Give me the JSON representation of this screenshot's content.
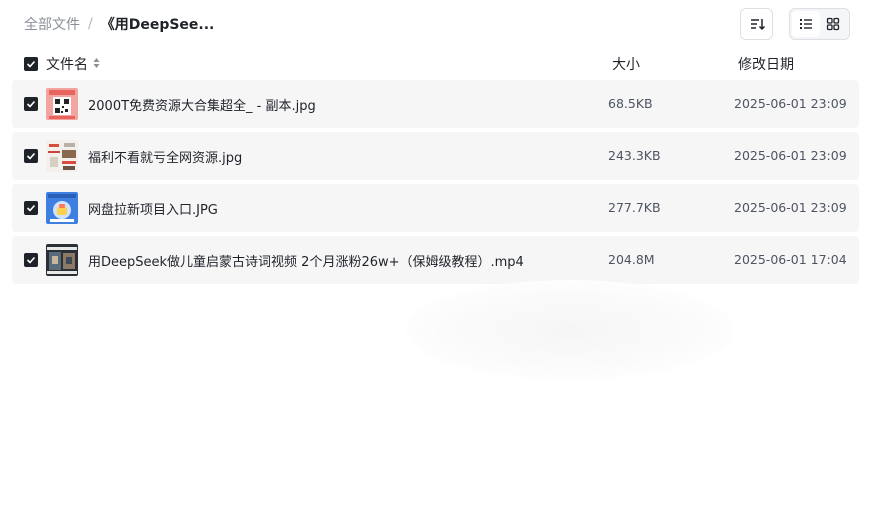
{
  "breadcrumb": {
    "root": "全部文件",
    "separator": "/",
    "current": "《用DeepSee..."
  },
  "toolbar": {
    "sort_icon": "sort-icon",
    "list_view_icon": "list-view-icon",
    "grid_view_icon": "grid-view-icon",
    "active_view": "list"
  },
  "columns": {
    "name": "文件名",
    "size": "大小",
    "modified": "修改日期"
  },
  "files": [
    {
      "name": "2000T免费资源大合集超全_ - 副本.jpg",
      "size": "68.5KB",
      "date": "2025-06-01 23:09",
      "checked": true,
      "thumb": "image"
    },
    {
      "name": "福利不看就亏全网资源.jpg",
      "size": "243.3KB",
      "date": "2025-06-01 23:09",
      "checked": true,
      "thumb": "image"
    },
    {
      "name": "网盘拉新项目入口.JPG",
      "size": "277.7KB",
      "date": "2025-06-01 23:09",
      "checked": true,
      "thumb": "image"
    },
    {
      "name": "用DeepSeek做儿童启蒙古诗词视频 2个月涨粉26w+（保姆级教程）.mp4",
      "size": "204.8M",
      "date": "2025-06-01 17:04",
      "checked": true,
      "thumb": "video"
    }
  ],
  "colors": {
    "row_background": "#f6f6f7",
    "checkbox": "#1f2329",
    "muted_text": "#8a8f99"
  }
}
